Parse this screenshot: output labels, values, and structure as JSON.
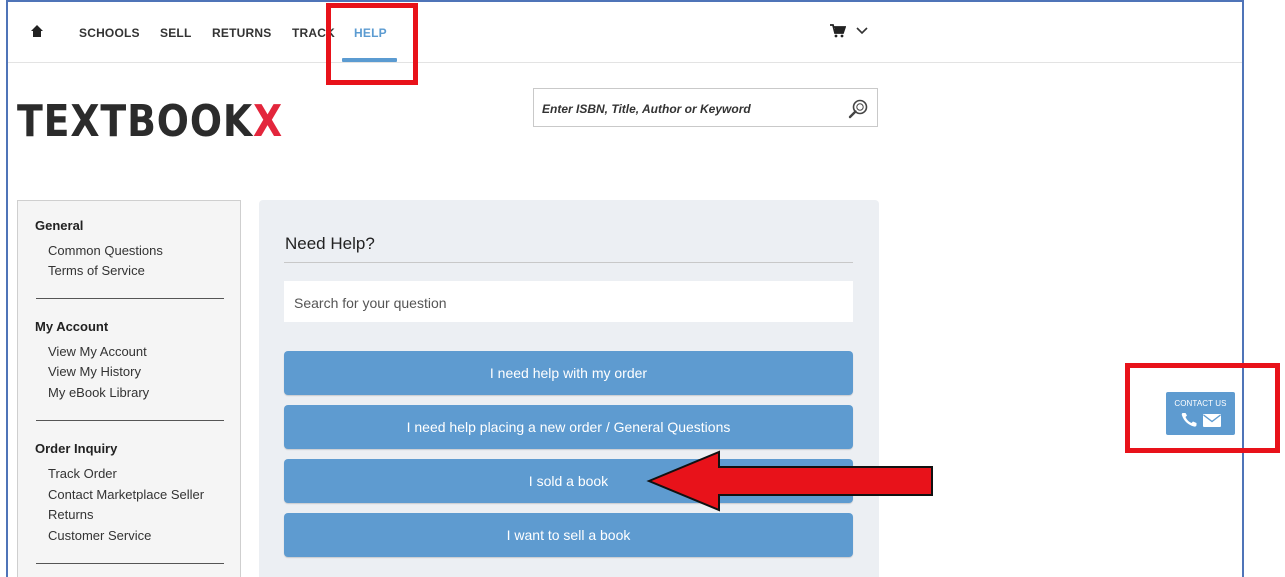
{
  "nav": {
    "items": [
      {
        "label": "SCHOOLS"
      },
      {
        "label": "SELL"
      },
      {
        "label": "RETURNS"
      },
      {
        "label": "TRACK"
      },
      {
        "label": "HELP",
        "active": true
      }
    ]
  },
  "logo": {
    "main": "TEXTBOOK",
    "accent": "X"
  },
  "search": {
    "placeholder": "Enter ISBN, Title, Author or Keyword"
  },
  "sidebar": {
    "sections": [
      {
        "heading": "General",
        "links": [
          "Common Questions",
          "Terms of Service"
        ]
      },
      {
        "heading": "My Account",
        "links": [
          "View My Account",
          "View My History",
          "My eBook Library"
        ]
      },
      {
        "heading": "Order Inquiry",
        "links": [
          "Track Order",
          "Contact Marketplace Seller",
          "Returns",
          "Customer Service"
        ]
      }
    ]
  },
  "help": {
    "title": "Need Help?",
    "search_placeholder": "Search for your question",
    "buttons": [
      "I need help with my order",
      "I need help placing a new order / General Questions",
      "I sold a book",
      "I want to sell a book"
    ]
  },
  "contact": {
    "label": "CONTACT US"
  },
  "colors": {
    "accent": "#5e9bd0",
    "brand_red": "#e3263c",
    "highlight": "#e8121a"
  },
  "icons": [
    "home-icon",
    "cart-icon",
    "chevron-down-icon",
    "search-icon",
    "phone-icon",
    "mail-icon"
  ]
}
